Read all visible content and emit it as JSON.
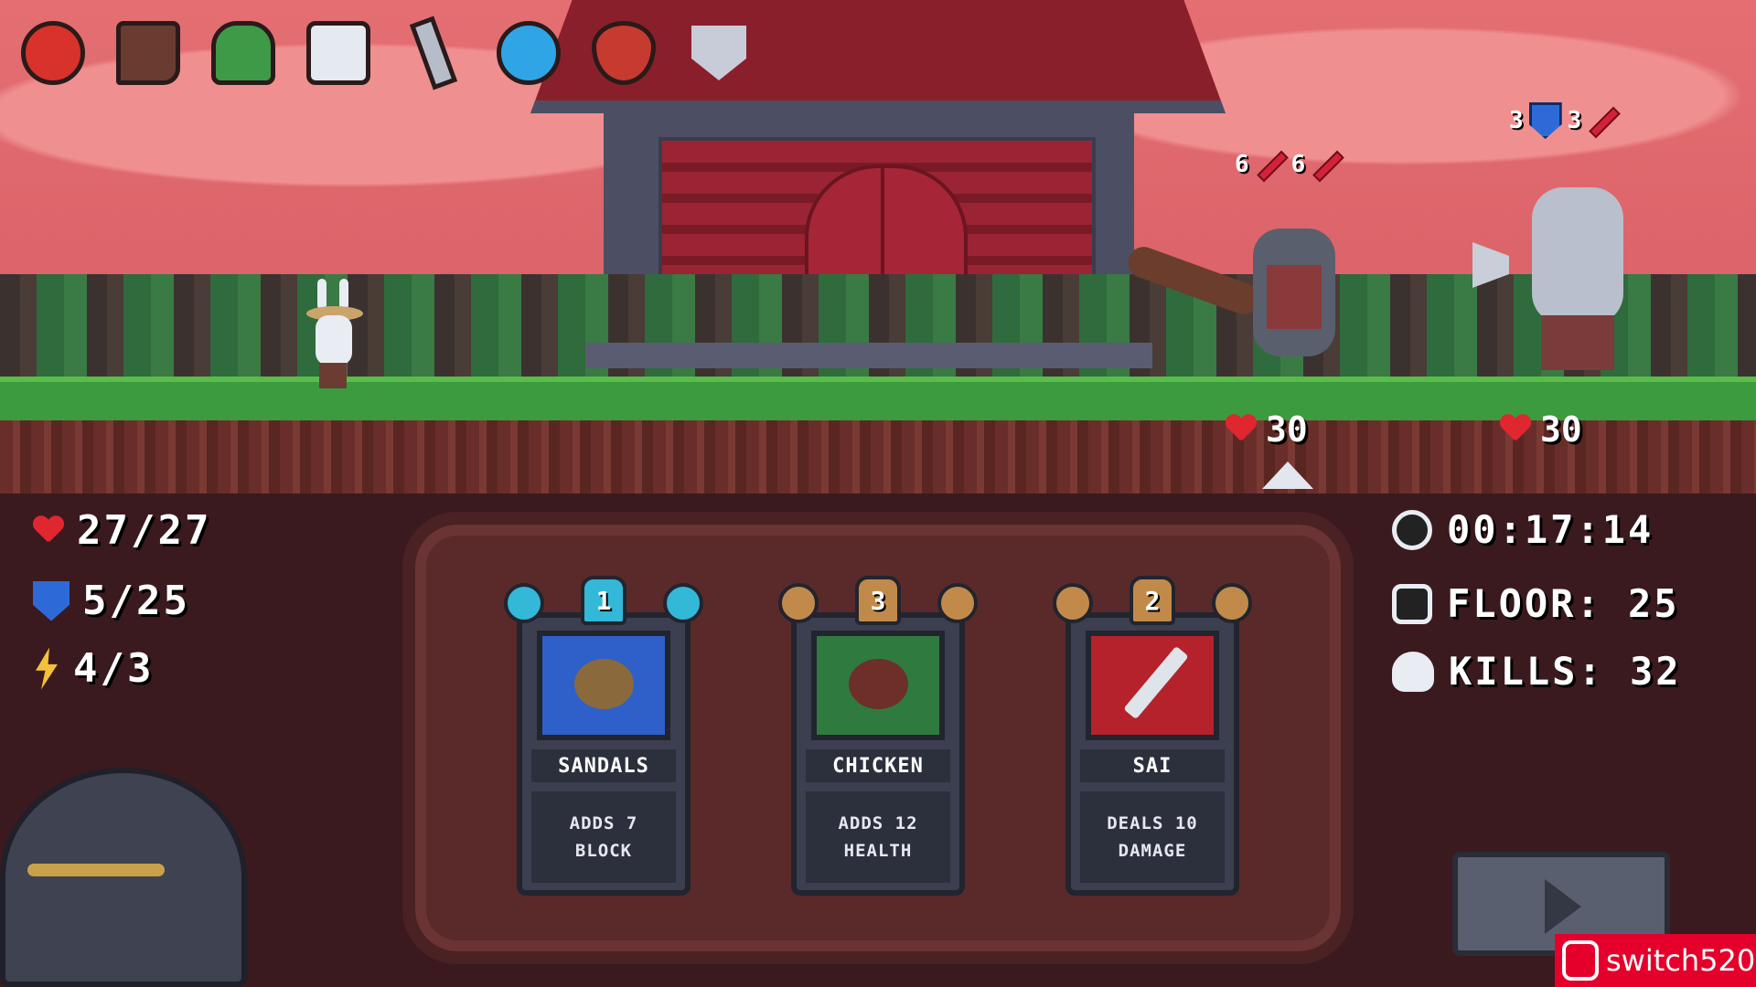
{
  "relics": [
    {
      "icon": "apple-icon"
    },
    {
      "icon": "boot-icon"
    },
    {
      "icon": "potted-plant-icon"
    },
    {
      "icon": "mug-icon"
    },
    {
      "icon": "dagger-icon"
    },
    {
      "icon": "blue-orb-icon"
    },
    {
      "icon": "amulet-icon"
    },
    {
      "icon": "shield-icon"
    }
  ],
  "player": {
    "health": "27/27",
    "block": "5/25",
    "energy": "4/3"
  },
  "run": {
    "timer": "00:17:14",
    "floor": "FLOOR: 25",
    "kills": "KILLS: 32"
  },
  "enemies": [
    {
      "name": "wolf-club",
      "intents": [
        "6",
        "6"
      ],
      "intent_icons": [
        "sword-icon",
        "sword-icon"
      ],
      "health": "30"
    },
    {
      "name": "wolf-axe",
      "intents": [
        "3",
        "3"
      ],
      "intent_icons": [
        "shield-icon",
        "sword-icon"
      ],
      "health": "30"
    }
  ],
  "cards": [
    {
      "cost": "1",
      "name": "SANDALS",
      "desc_line1": "ADDS 7",
      "desc_line2": "BLOCK",
      "color": "#2f5fc9"
    },
    {
      "cost": "3",
      "name": "CHICKEN",
      "desc_line1": "ADDS 12",
      "desc_line2": "HEALTH",
      "color": "#2f7a3f"
    },
    {
      "cost": "2",
      "name": "SAI",
      "desc_line1": "DEALS 10",
      "desc_line2": "DAMAGE",
      "color": "#b5222b"
    }
  ],
  "watermark": "switch520"
}
